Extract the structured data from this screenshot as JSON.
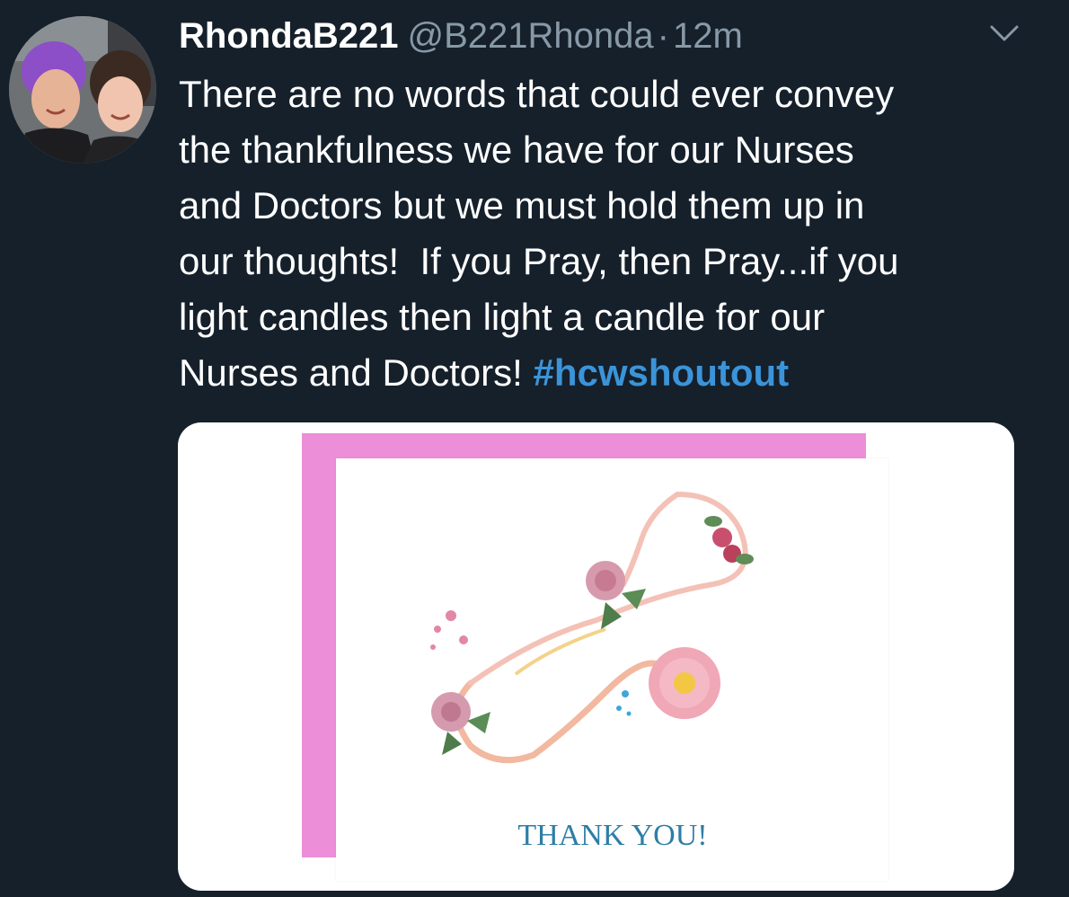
{
  "tweet": {
    "display_name": "RhondaB221",
    "handle": "@B221Rhonda",
    "separator": "·",
    "timestamp": "12m",
    "text": "There are no words that could ever convey\nthe thankfulness we have for our Nurses\nand Doctors but we must hold them up in\nour thoughts!  If you Pray, then Pray...if you\nlight candles then light a candle for our\nNurses and Doctors! ",
    "hashtag": "#hcwshoutout"
  },
  "media": {
    "card_message": "THANK YOU!"
  },
  "icons": {
    "caret": "chevron-down-icon",
    "avatar": "profile-photo"
  },
  "colors": {
    "background": "#15202b",
    "secondary_text": "#8899a6",
    "hashtag": "#3b94d9",
    "envelope": "#ec8fd8",
    "card_text": "#2e7ea6"
  }
}
